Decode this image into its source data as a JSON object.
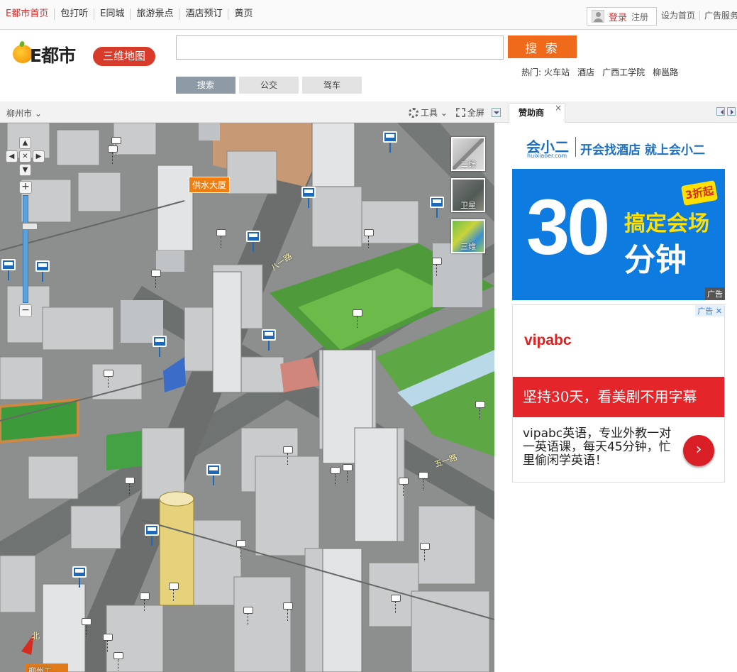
{
  "topnav": {
    "items": [
      "E都市首页",
      "包打听",
      "E同城",
      "旅游景点",
      "酒店预订",
      "黄页"
    ],
    "login": "登录",
    "register": "注册",
    "links": [
      "设为首页",
      "广告服务"
    ]
  },
  "header": {
    "logo_text": "E都市",
    "badge": "三维地图",
    "search_placeholder": "",
    "search_button": "搜 索",
    "hot_label": "热门:",
    "hot_items": [
      "火车站",
      "酒店",
      "广西工学院",
      "柳邕路"
    ],
    "tabs": [
      "搜索",
      "公交",
      "驾车"
    ]
  },
  "toolbar": {
    "city": "柳州市",
    "tools": "工具",
    "fullscreen": "全屏"
  },
  "sidebar": {
    "tab": "赞助商",
    "close": "×"
  },
  "map": {
    "mode_2d": "二维",
    "mode_satellite": "卫星",
    "mode_3d": "三维",
    "poi": "供水大厦",
    "roads": [
      "八一路",
      "五一路"
    ],
    "compass": "北",
    "bottom_label": "柳州工..."
  },
  "ad1": {
    "brand": "会小二",
    "url": "huixiaoer.com",
    "slogan": "开会找酒店 就上会小二",
    "number": "30",
    "line1": "搞定会场",
    "line2": "分钟",
    "discount": "3折起",
    "tag": "广告"
  },
  "ad2": {
    "tag": "广告 ✕",
    "brand": "vipabc",
    "banner": "坚持30天，看美剧不用字幕",
    "desc": "vipabc英语，专业外教一对一英语课，每天45分钟，忙里偷闲学英语！",
    "go": "›"
  }
}
